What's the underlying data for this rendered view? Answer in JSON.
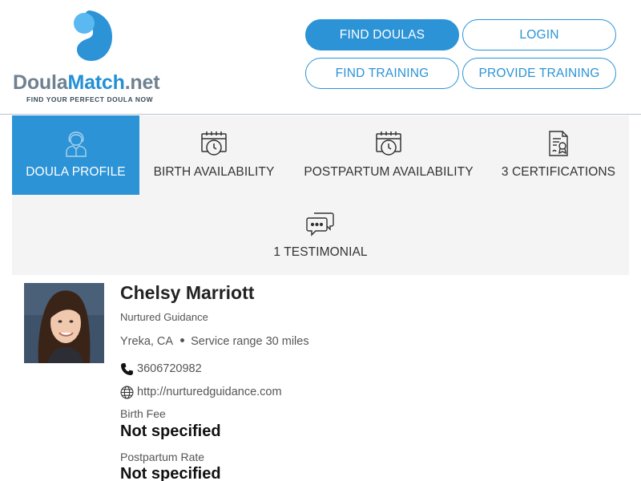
{
  "brand": {
    "name_part1": "Doula",
    "name_part2": "Match",
    "name_part3": ".net",
    "tagline": "FIND YOUR PERFECT DOULA NOW",
    "colors": {
      "primary": "#2b93d6",
      "light_blue": "#5ab9f0",
      "gray": "#6f8190"
    }
  },
  "nav": {
    "find_doulas": "FIND DOULAS",
    "login": "LOGIN",
    "find_training": "FIND TRAINING",
    "provide_training": "PROVIDE TRAINING"
  },
  "tabs": [
    {
      "label": "DOULA PROFILE",
      "icon": "doula-person-icon",
      "active": true
    },
    {
      "label": "BIRTH AVAILABILITY",
      "icon": "calendar-clock-icon",
      "active": false
    },
    {
      "label": "POSTPARTUM AVAILABILITY",
      "icon": "calendar-clock-icon",
      "active": false
    },
    {
      "label": "3 CERTIFICATIONS",
      "icon": "certificate-icon",
      "active": false
    },
    {
      "label": "1 TESTIMONIAL",
      "icon": "chat-bubbles-icon",
      "active": false
    }
  ],
  "profile": {
    "name": "Chelsy Marriott",
    "agency": "Nurtured Guidance",
    "city": "Yreka, CA",
    "service_range": "Service range 30 miles",
    "phone": "3606720982",
    "website": "http://nurturedguidance.com",
    "birth_fee_label": "Birth Fee",
    "birth_fee_value": "Not specified",
    "postpartum_rate_label": "Postpartum Rate",
    "postpartum_rate_value": "Not specified"
  }
}
